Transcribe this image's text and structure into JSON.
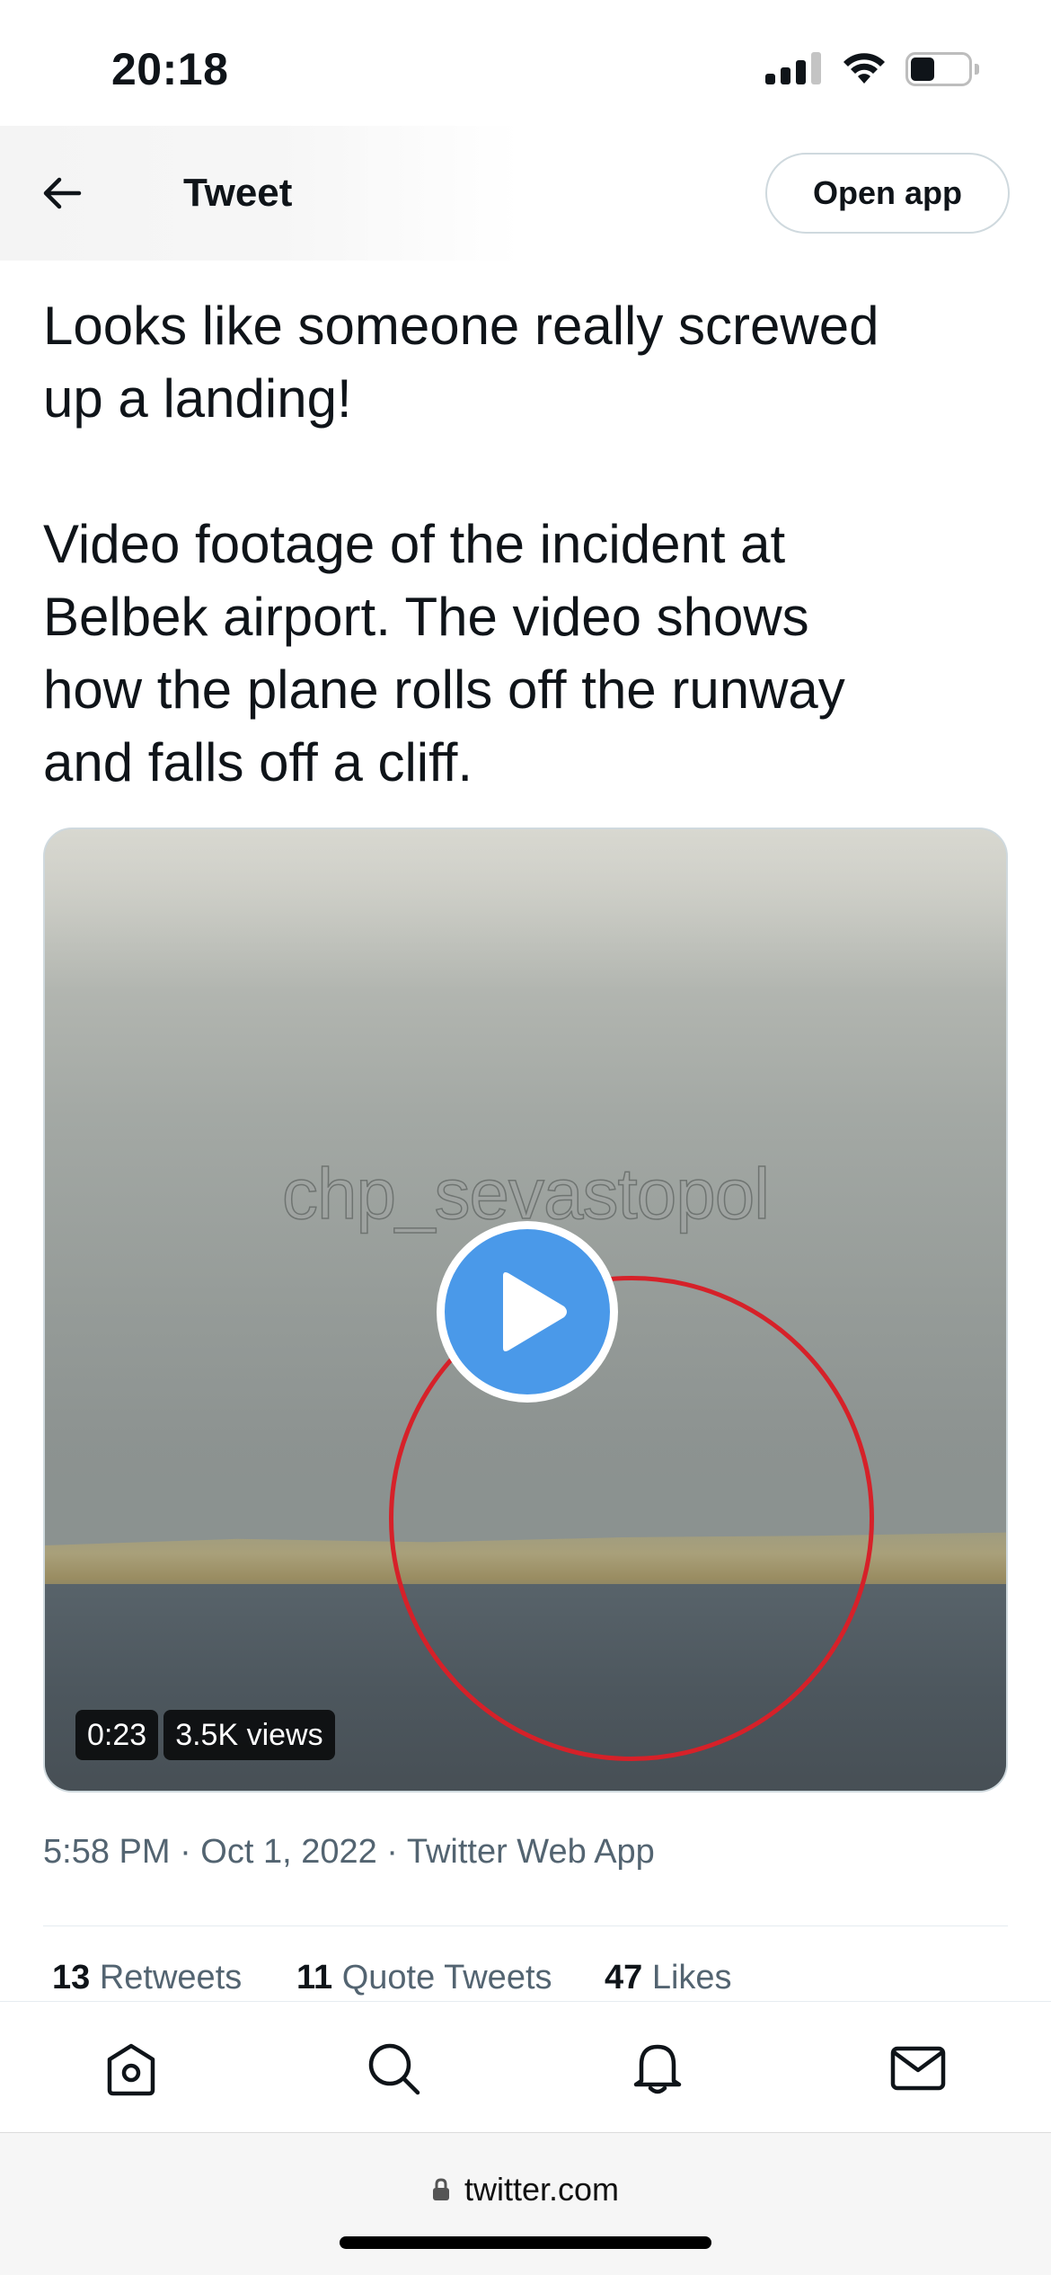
{
  "status_bar": {
    "time": "20:18",
    "signal_icon": "cellular-signal-icon",
    "wifi_icon": "wifi-icon",
    "battery_icon": "battery-icon",
    "battery_level": 0.35
  },
  "header": {
    "back_icon": "arrow-left-icon",
    "title": "Tweet",
    "open_app_label": "Open app"
  },
  "tweet": {
    "text_lines": [
      "Looks like someone really screwed",
      "up a landing!",
      "",
      "Video footage of the incident at",
      "Belbek airport. The video shows",
      "how the plane rolls off the runway",
      "and falls off a cliff."
    ],
    "video": {
      "watermark": "chp_sevastopol",
      "play_icon": "play-icon",
      "duration": "0:23",
      "views": "3.5K views"
    },
    "meta": "5:58 PM · Oct 1, 2022 · Twitter Web App",
    "stats": {
      "retweets_count": "13",
      "retweets_label": "Retweets",
      "quotes_count": "11",
      "quotes_label": "Quote Tweets",
      "likes_count": "47",
      "likes_label": "Likes"
    }
  },
  "bottom_nav": {
    "items": [
      {
        "icon": "home-icon"
      },
      {
        "icon": "search-icon"
      },
      {
        "icon": "bell-icon"
      },
      {
        "icon": "mail-icon"
      }
    ]
  },
  "browser": {
    "url": "twitter.com",
    "lock_icon": "lock-icon"
  },
  "colors": {
    "accent": "#1d9bf0",
    "play_button": "#4a99e9",
    "annotation_circle": "#d62129",
    "secondary_text": "#536471"
  }
}
